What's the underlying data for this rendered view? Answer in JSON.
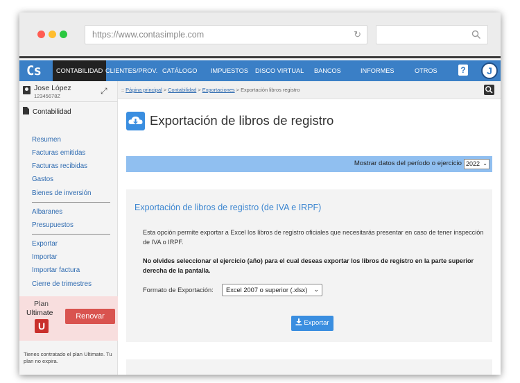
{
  "browser": {
    "url": "https://www.contasimple.com"
  },
  "app": {
    "logo": "Cs",
    "nav": [
      "CONTABILIDAD",
      "CLIENTES/PROV.",
      "CATÁLOGO",
      "IMPUESTOS",
      "DISCO VIRTUAL",
      "BANCOS",
      "INFORMES",
      "OTROS"
    ],
    "help_label": "?",
    "avatar_initial": "J"
  },
  "sidebar": {
    "user_name": "Jose López",
    "user_id": "12345678Z",
    "section_title": "Contabilidad",
    "group1": [
      "Resumen",
      "Facturas emitidas",
      "Facturas recibidas",
      "Gastos",
      "Bienes de inversión"
    ],
    "group2": [
      "Albaranes",
      "Presupuestos"
    ],
    "group3": [
      "Exportar",
      "Importar",
      "Importar factura",
      "Cierre de trimestres"
    ],
    "plan_label": "Plan",
    "plan_name": "Ultimate",
    "plan_badge": "U",
    "renew_label": "Renovar",
    "plan_note": "Tienes contratado el plan Ultimate. Tu plan no expira."
  },
  "breadcrumb": {
    "items": [
      "Página principal",
      "Contabilidad",
      "Exportaciones"
    ],
    "current": "Exportación libros registro",
    "prefix": "::",
    "separator": ">"
  },
  "main": {
    "page_title": "Exportación de libros de registro",
    "period_label": "Mostrar datos del período o ejercicio",
    "period_value": "2022",
    "card_title": "Exportación de libros de registro (de IVA e IRPF)",
    "description": "Esta opción permite exportar a Excel los libros de registro oficiales que necesitarás presentar en caso de tener inspección de IVA o IRPF.",
    "notice": "No olvides seleccionar el ejercicio (año) para el cual deseas exportar los libros de registro en la parte superior derecha de la pantalla.",
    "format_label": "Formato de Exportación:",
    "format_value": "Excel 2007 o superior (.xlsx)",
    "export_label": "Exportar"
  },
  "colors": {
    "brand": "#3a7fc6",
    "accent": "#3a8ee0",
    "danger": "#d9534f"
  }
}
